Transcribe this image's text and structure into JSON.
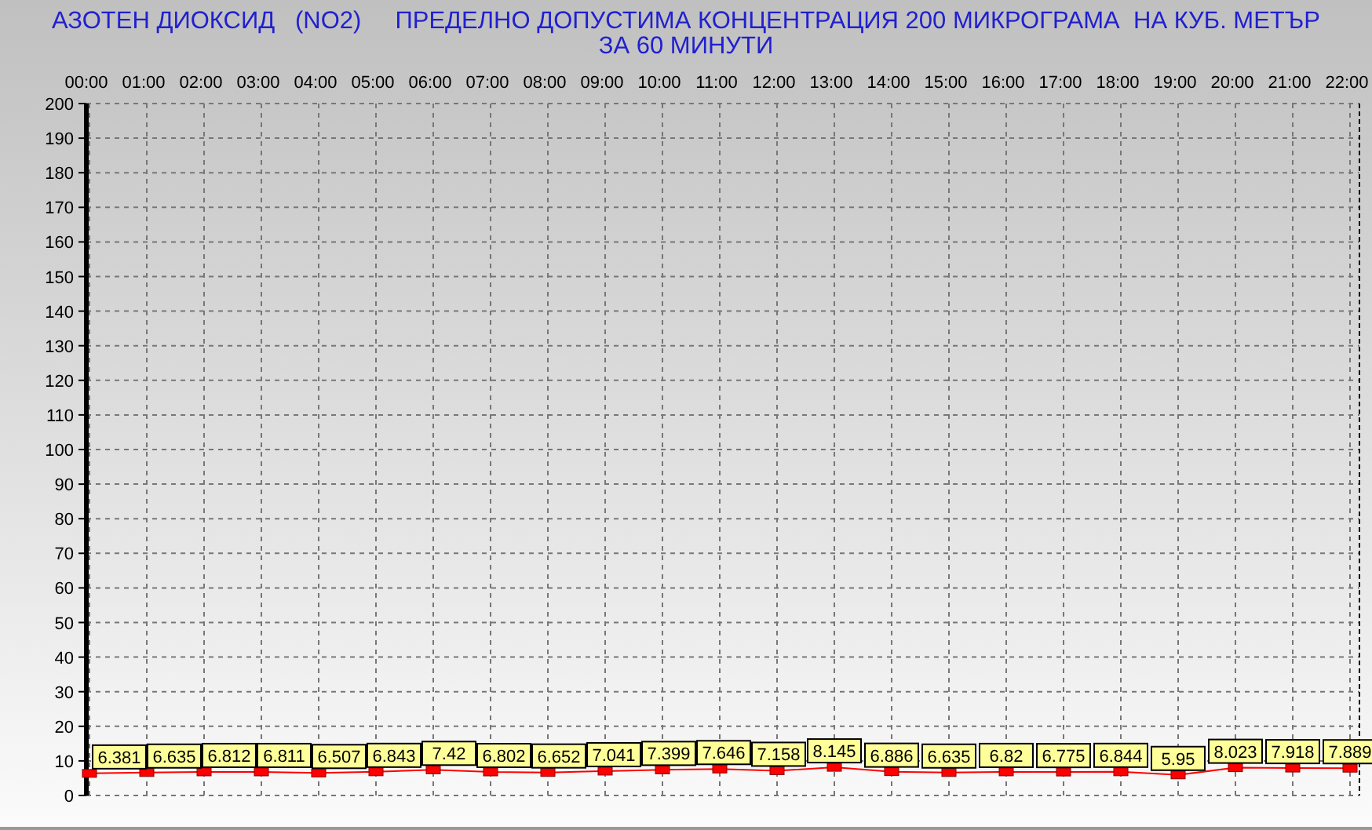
{
  "title": "АЗОТЕН ДИОКСИД   (NO2)     ПРЕДЕЛНО ДОПУСТИМА КОНЦЕНТРАЦИЯ 200 МИКРОГРАМА  НА КУБ. МЕТЪР",
  "subtitle": "ЗА 60 МИНУТИ",
  "chart_data": {
    "type": "line",
    "categories": [
      "00:00",
      "01:00",
      "02:00",
      "03:00",
      "04:00",
      "05:00",
      "06:00",
      "07:00",
      "08:00",
      "09:00",
      "10:00",
      "11:00",
      "12:00",
      "13:00",
      "14:00",
      "15:00",
      "16:00",
      "17:00",
      "18:00",
      "19:00",
      "20:00",
      "21:00",
      "22:00"
    ],
    "series": [
      {
        "color": "#ff0000",
        "marker": "square",
        "values": [
          6.381,
          6.635,
          6.812,
          6.811,
          6.507,
          6.843,
          7.42,
          6.802,
          6.652,
          7.041,
          7.399,
          7.646,
          7.158,
          8.145,
          6.886,
          6.635,
          6.82,
          6.775,
          6.844,
          5.95,
          8.023,
          7.918,
          7.889
        ]
      }
    ],
    "ylim": [
      0,
      200
    ],
    "yticks": [
      0,
      10,
      20,
      30,
      40,
      50,
      60,
      70,
      80,
      90,
      100,
      110,
      120,
      130,
      140,
      150,
      160,
      170,
      180,
      190,
      200
    ],
    "grid": true,
    "data_labels": true
  }
}
